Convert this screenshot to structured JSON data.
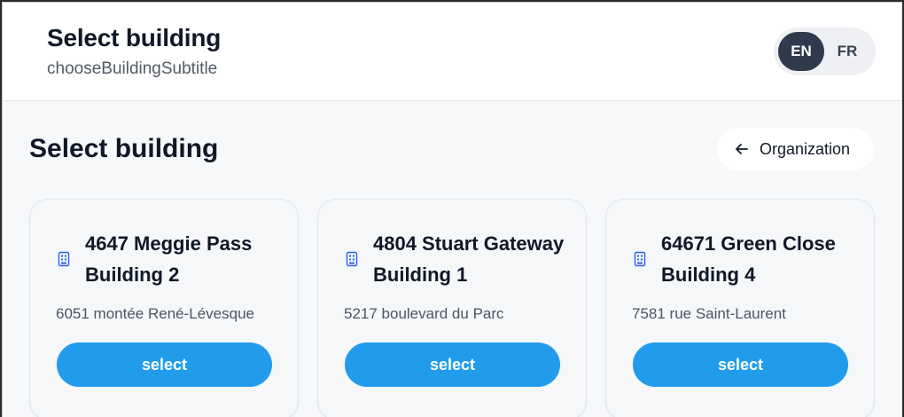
{
  "header": {
    "title": "Select building",
    "subtitle": "chooseBuildingSubtitle"
  },
  "language": {
    "options": [
      "EN",
      "FR"
    ],
    "selected": "EN"
  },
  "main": {
    "title": "Select building",
    "back_label": "Organization",
    "back_icon": "arrow-left-icon"
  },
  "buildings": [
    {
      "name": "4647 Meggie Pass Building 2",
      "address": "6051 montée René-Lévesque",
      "button_label": "select",
      "icon": "building-icon"
    },
    {
      "name": "4804 Stuart Gateway Building 1",
      "address": "5217 boulevard du Parc",
      "button_label": "select",
      "icon": "building-icon"
    },
    {
      "name": "64671 Green Close Building 4",
      "address": "7581 rue Saint-Laurent",
      "button_label": "select",
      "icon": "building-icon"
    }
  ],
  "colors": {
    "accent": "#219ceb",
    "toggle_active": "#2f3b4c",
    "background": "#f6f8fa"
  }
}
